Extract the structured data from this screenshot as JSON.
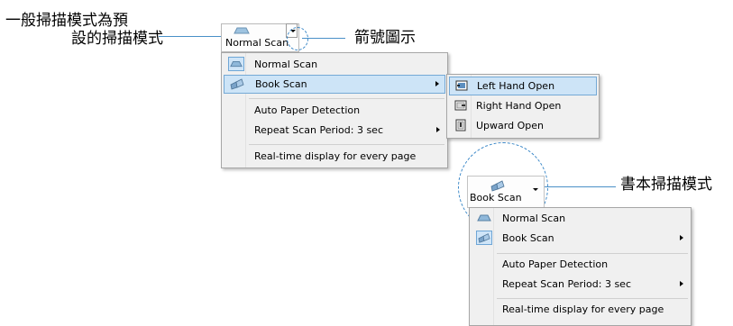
{
  "annotations": {
    "default_mode_line1": "一般掃描模式為預",
    "default_mode_line2": "設的掃描模式",
    "arrow_icon": "箭號圖示",
    "book_mode": "書本掃描模式"
  },
  "scan_button": {
    "label": "Normal Scan",
    "icon": "document-scanner-icon"
  },
  "menu": {
    "items": [
      {
        "label": "Normal Scan",
        "icon": "normal-scan-icon"
      },
      {
        "label": "Book Scan",
        "icon": "book-scan-icon"
      },
      {
        "label": "Auto Paper Detection"
      },
      {
        "label": "Repeat Scan Period:  3 sec"
      },
      {
        "label": "Real-time display for every page"
      }
    ]
  },
  "submenu": {
    "items": [
      {
        "label": "Left Hand Open",
        "icon": "left-hand-open-icon"
      },
      {
        "label": "Right Hand Open",
        "icon": "right-hand-open-icon"
      },
      {
        "label": "Upward Open",
        "icon": "upward-open-icon"
      }
    ]
  },
  "book_button": {
    "label": "Book Scan",
    "icon": "book-scan-icon"
  },
  "menu2": {
    "items": [
      {
        "label": "Normal Scan"
      },
      {
        "label": "Book Scan"
      },
      {
        "label": "Auto Paper Detection"
      },
      {
        "label": "Repeat Scan Period:  3 sec"
      },
      {
        "label": "Real-time display for every page"
      }
    ]
  },
  "colors": {
    "highlight": "#cde4f7",
    "highlight_border": "#74a9d6",
    "callout_line": "#4a90c8"
  }
}
